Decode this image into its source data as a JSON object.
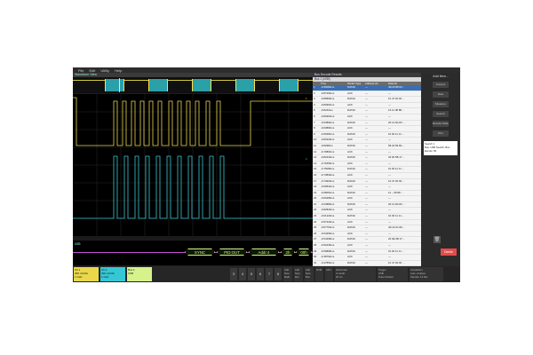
{
  "menu": [
    "File",
    "Edit",
    "Utility",
    "Help"
  ],
  "waveform_view_title": "Waveform View",
  "overview_indicator": "800 ms/div",
  "bus_segments": [
    "SYNC",
    "PID:OUT",
    "Addr:4",
    "2h",
    "00h"
  ],
  "bus_label": "USB",
  "results": {
    "title": "Bus Decode Results",
    "tab": "Bus 1 (USB)",
    "columns": [
      "",
      "Time",
      "Packet Type",
      "Address (h)",
      "Data (h)"
    ],
    "rows": [
      [
        "1",
        "-9.95082ms",
        "DATA0",
        "---",
        "4D 00 88 04 ..."
      ],
      [
        "2",
        "-9.87296ms",
        "ACK",
        "---",
        "---"
      ],
      [
        "3",
        "-9.85899ms",
        "DATA0",
        "---",
        "10 47 00 00 ..."
      ],
      [
        "4",
        "-9.83963ms",
        "ACK",
        "---",
        "---"
      ],
      [
        "5",
        "-9.8243ms",
        "DATA0",
        "---",
        "16 11 08 88 ..."
      ],
      [
        "6",
        "-9.80303ms",
        "ACK",
        "---",
        "---"
      ],
      [
        "7",
        "-9.64893ms",
        "DATA0",
        "---",
        "26 12 8A 8C ..."
      ],
      [
        "8",
        "-9.60896ms",
        "ACK",
        "---",
        "---"
      ],
      [
        "9",
        "-9.95484ms",
        "DATA0",
        "---",
        "01 00 11 11 ..."
      ],
      [
        "10",
        "-9.83429ms",
        "ACK",
        "---",
        "---"
      ],
      [
        "11",
        "-9.8298ms",
        "DATA0",
        "---",
        "68 22 83 8A ..."
      ],
      [
        "12",
        "-9.79863ms",
        "ACK",
        "---",
        "---"
      ],
      [
        "13",
        "-9.82429ms",
        "DATA0",
        "---",
        "33 00 5B 17 ..."
      ],
      [
        "14",
        "-9.76496ms",
        "ACK",
        "---",
        "---"
      ],
      [
        "15",
        "-9.75086ms",
        "DATA0",
        "---",
        "01 00 11 11 ..."
      ],
      [
        "16",
        "-9.73839ms",
        "ACK",
        "---",
        "---"
      ],
      [
        "17",
        "-9.73929ms",
        "DATA0",
        "---",
        "10 47 00 00 ..."
      ],
      [
        "18",
        "-9.69542ms",
        "ACK",
        "---",
        "---"
      ],
      [
        "19",
        "-9.68052ms",
        "DATA0",
        "---",
        "11 -- 08 88 ..."
      ],
      [
        "20",
        "-9.66489ms",
        "ACK",
        "---",
        "---"
      ],
      [
        "21",
        "-9.64889ms",
        "DATA0",
        "---",
        "26 12 8A 8C ..."
      ],
      [
        "22",
        "-9.82829ms",
        "ACK",
        "---",
        "---"
      ],
      [
        "23",
        "-9.61229ms",
        "DATA0",
        "---",
        "01 00 11 11 ..."
      ],
      [
        "24",
        "-9.57429ms",
        "ACK",
        "---",
        "---"
      ],
      [
        "25",
        "-9.57763ms",
        "DATA0",
        "---",
        "4D 22 01 8A ..."
      ],
      [
        "26",
        "-9.54459ms",
        "ACK",
        "---",
        "---"
      ],
      [
        "27",
        "-9.54298ms",
        "DATA0",
        "---",
        "20 0E 5B 17 ..."
      ],
      [
        "28",
        "-9.52239ms",
        "ACK",
        "---",
        "---"
      ],
      [
        "29",
        "-9.59898ms",
        "DATA0",
        "---",
        "01 00 11 11 ..."
      ],
      [
        "30",
        "-9.48792ms",
        "ACK",
        "---",
        "---"
      ],
      [
        "31",
        "-9.47852ms",
        "DATA0",
        "---",
        "10 47 00 00 ..."
      ]
    ]
  },
  "right_panel": {
    "title": "Add New...",
    "buttons": [
      "Cursors",
      "Note",
      "Measure",
      "Search",
      "Results Table",
      "Plot"
    ],
    "search_title": "Search 1",
    "search_text": "Bus: USB Search: Bus Events: 50",
    "delete_label": "Delete"
  },
  "bottom": {
    "ch1": {
      "name": "Ch 1",
      "line1": "400 mV/div",
      "line2": "1 GHz"
    },
    "ch2": {
      "name": "Ch 2",
      "line1": "400 mV/div",
      "line2": "1 GHz"
    },
    "bus": {
      "name": "Bus 1",
      "line1": "USB"
    },
    "numbers": [
      "3",
      "4",
      "5",
      "6",
      "7",
      "8"
    ],
    "extras": [
      "Add New Math",
      "Add New Ref",
      "Add New Bus",
      "DVM",
      "AFG"
    ],
    "horizontal": {
      "name": "Horizontal",
      "line1": "2 ms/div",
      "line2": "20 ms",
      "line3": "SR: 12.5 GS/s",
      "line4": "RL: 250 Mpts"
    },
    "trigger": {
      "name": "Trigger",
      "line1": "USB",
      "line2": "Token Packet"
    },
    "acquisition": {
      "name": "Acquisition",
      "line1": "Auto, Analyze",
      "line2": "Sample: 12 bits",
      "line3": "Single: 1/1"
    }
  },
  "colors": {
    "ch1": "#e8d84a",
    "ch2": "#36c7d4",
    "bus": "#d5f28c",
    "accent": "#3c6fb0"
  }
}
